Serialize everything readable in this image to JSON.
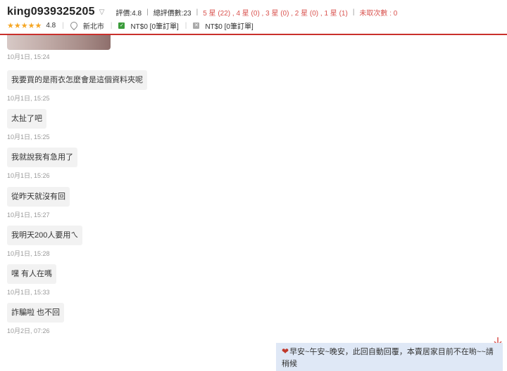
{
  "header": {
    "username": "king0939325205",
    "rating": "評價:4.8",
    "total_ratings": "總評價數:23",
    "breakdown": "5 星 (22) , 4 星 (0) , 3 星 (0) , 2 星 (0) , 1 星 (1)",
    "cancellations": "未取次數 : 0",
    "stars": "★★★★★",
    "score": "4.8",
    "location": "新北市",
    "completed_orders": "NT$0 [0筆訂單]",
    "cancelled_orders": "NT$0 [0筆訂單]",
    "accent_color": "#c9302c"
  },
  "messages": [
    {
      "text": "",
      "time": "10月1日, 15:24"
    },
    {
      "text": "我要買的是雨衣怎麼會是這個資料夾呢",
      "time": "10月1日, 15:25"
    },
    {
      "text": "太扯了吧",
      "time": "10月1日, 15:25"
    },
    {
      "text": "我就說我有急用了",
      "time": "10月1日, 15:26"
    },
    {
      "text": "從昨天就沒有回",
      "time": "10月1日, 15:27"
    },
    {
      "text": "我明天200人要用ㄟ",
      "time": "10月1日, 15:28"
    },
    {
      "text": "嘿 有人在嗎",
      "time": "10月1日, 15:33"
    },
    {
      "text": "詐騙啦 也不回",
      "time": "10月2日, 07:26"
    }
  ],
  "auto_reply": {
    "heart": "❤",
    "text": "早安~午安~晚安，此回自動回覆，本賣居家目前不在喲~~請稍候",
    "background": "#dfe8f6"
  }
}
